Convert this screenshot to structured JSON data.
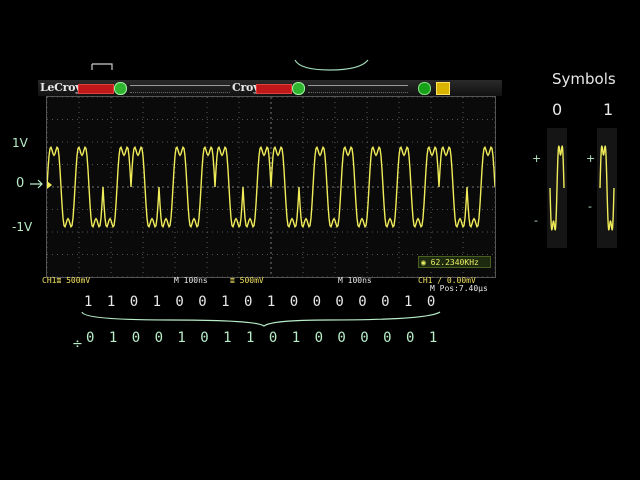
{
  "oscilloscope": {
    "brand_left": "LeCroy",
    "brand_right": "Croy",
    "ch1_scale": "CH1≣ 500mV",
    "timebase_left": "M 100ns",
    "ch_scale_mid": "≣ 500mV",
    "timebase_right": "M 100ns",
    "trigger_level": "CH1 ∕ 0.00mV",
    "position": "M Pos:7.40μs",
    "frequency": "62.2340KHz"
  },
  "annotations": {
    "level_high": "1V",
    "level_zero": "0",
    "level_low": "-1V",
    "symbols_title": "Symbols",
    "symbol_zero": "0",
    "symbol_one": "1",
    "bits_top": "1 1 0 1 0 0 1 0 1 0 0 0 0 0 1 0",
    "bits_bottom": "0 1 0 0 1 0 1 1 0 1 0 0 0 0 0 1"
  },
  "colors": {
    "trace": "#f0ec5a",
    "grid": "#6e6e6e",
    "annotation": "#b8eec8"
  },
  "icons": {
    "trigger": "trigger-status-icon",
    "speaker": "speaker-icon",
    "frequency": "frequency-counter-icon"
  }
}
